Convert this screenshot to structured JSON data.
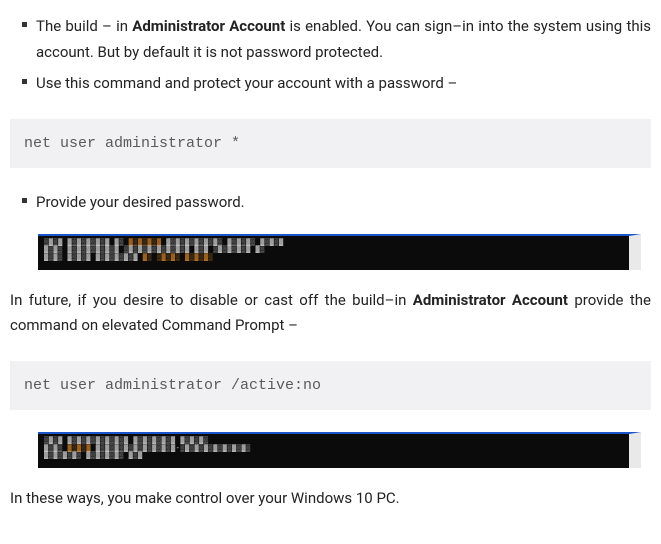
{
  "bullets_1": [
    {
      "pre": "The build – in ",
      "bold": "Administrator Account",
      "post": " is enabled. You can sign–in into the system using this account. But by default it is not password protected."
    },
    {
      "pre": "",
      "bold": "",
      "post": "Use this command and protect your account with a password –"
    }
  ],
  "code_1": "net user administrator *",
  "bullets_2": [
    {
      "pre": "",
      "bold": "",
      "post": "Provide your desired password."
    }
  ],
  "para_1": {
    "pre": "In future, if you desire to disable or cast off the build–in ",
    "bold": "Administrator Account",
    "post": " provide the command on elevated Command Prompt –"
  },
  "code_2": "net user administrator /active:no",
  "para_2": "In these ways, you make control over your Windows 10 PC."
}
